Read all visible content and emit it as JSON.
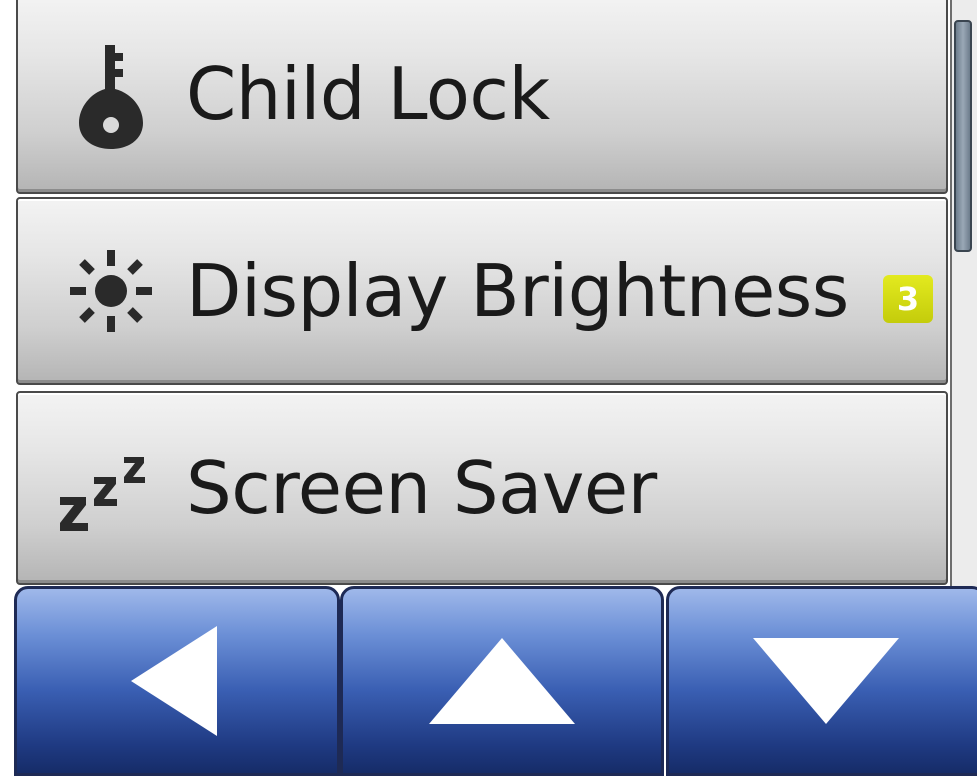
{
  "menu": {
    "items": [
      {
        "label": "Child Lock",
        "icon": "lock-icon"
      },
      {
        "label": "Display Brightness",
        "icon": "brightness-icon",
        "badge": "3"
      },
      {
        "label": "Screen Saver",
        "icon": "sleep-icon"
      }
    ]
  },
  "nav": {
    "buttons": [
      {
        "icon": "arrow-left-icon"
      },
      {
        "icon": "arrow-up-icon"
      },
      {
        "icon": "arrow-down-icon"
      }
    ]
  },
  "colors": {
    "badge": "#d6dd14",
    "nav_blue": "#3a5fb3",
    "text": "#1a1a1a"
  }
}
